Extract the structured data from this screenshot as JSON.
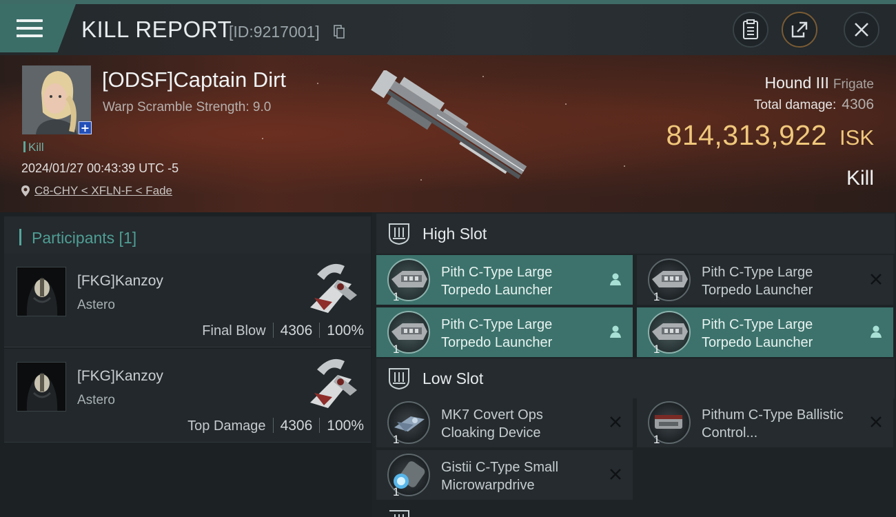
{
  "header": {
    "title": "KILL REPORT",
    "report_id": "[ID:9217001]",
    "icons": [
      "menu-icon",
      "copy-icon",
      "clipboard-icon",
      "share-icon",
      "close-icon"
    ]
  },
  "victim": {
    "name": "[ODSF]Captain Dirt",
    "warp_scramble": "Warp Scramble Strength: 9.0",
    "kill_tag": "Kill",
    "datetime": "2024/01/27 00:43:39 UTC -5",
    "location": "C8-CHY < XFLN-F < Fade",
    "ship_name": "Hound III",
    "ship_class": "Frigate",
    "total_damage_label": "Total damage:",
    "total_damage": "4306",
    "isk_value": "814,313,922",
    "isk_unit": "ISK",
    "result": "Kill"
  },
  "participants": {
    "title": "Participants [1]",
    "rows": [
      {
        "name": "[FKG]Kanzoy",
        "ship": "Astero",
        "role": "Final Blow",
        "damage": "4306",
        "percent": "100%"
      },
      {
        "name": "[FKG]Kanzoy",
        "ship": "Astero",
        "role": "Top Damage",
        "damage": "4306",
        "percent": "100%"
      }
    ]
  },
  "slots": {
    "high": {
      "title": "High Slot",
      "modules": [
        {
          "name": "Pith C-Type Large Torpedo Launcher",
          "qty": "1",
          "active": true
        },
        {
          "name": "Pith C-Type Large Torpedo Launcher",
          "qty": "1",
          "active": false
        },
        {
          "name": "Pith C-Type Large Torpedo Launcher",
          "qty": "1",
          "active": true
        },
        {
          "name": "Pith C-Type Large Torpedo Launcher",
          "qty": "1",
          "active": true
        }
      ]
    },
    "low": {
      "title": "Low Slot",
      "modules": [
        {
          "name": "MK7 Covert Ops Cloaking Device",
          "qty": "1",
          "active": false
        },
        {
          "name": "Pithum C-Type Ballistic Control...",
          "qty": "1",
          "active": false
        },
        {
          "name": "Gistii C-Type Small Microwarpdrive",
          "qty": "1",
          "active": false
        }
      ]
    }
  },
  "colors": {
    "accent_teal": "#3c726b",
    "isk_gold": "#f0c77b",
    "participant_title": "#4f9e94"
  }
}
